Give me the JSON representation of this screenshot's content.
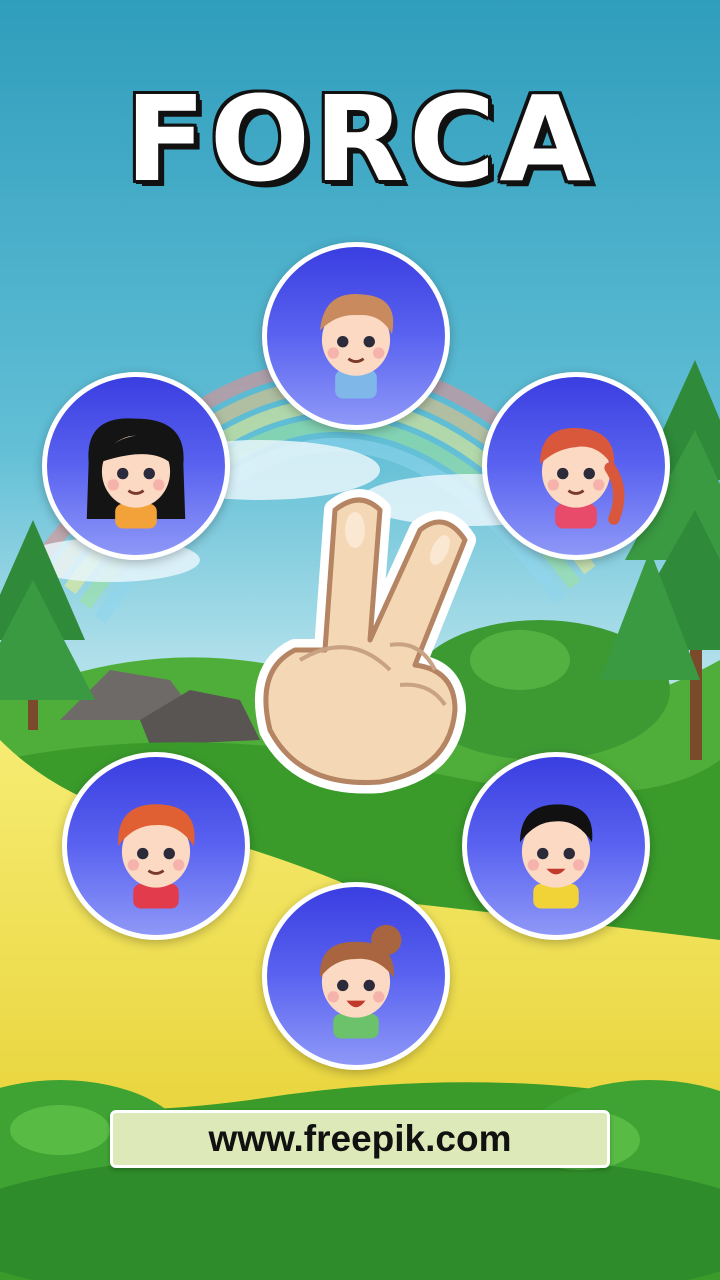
{
  "title": "FORCA",
  "footer": {
    "link_text": "www.freepik.com"
  },
  "hand": {
    "icon": "peace-hand-icon"
  },
  "avatars": [
    {
      "id": "boy-brown-hair",
      "hair": "#c98a5e",
      "shirt": "#7fb8e8",
      "skin": "#fbd9c2"
    },
    {
      "id": "girl-black-hair",
      "hair": "#141414",
      "shirt": "#f3a23a",
      "skin": "#fbd9c2"
    },
    {
      "id": "girl-red-braid",
      "hair": "#d9573b",
      "shirt": "#e84a6a",
      "skin": "#fbd9c2"
    },
    {
      "id": "boy-red-hair",
      "hair": "#e06034",
      "shirt": "#e23b4b",
      "skin": "#fbd9c2"
    },
    {
      "id": "boy-black-hair",
      "hair": "#111111",
      "shirt": "#f2d337",
      "skin": "#fbd9c2"
    },
    {
      "id": "girl-brown-bun",
      "hair": "#a8653f",
      "shirt": "#6cc26a",
      "skin": "#fbd9c2"
    }
  ],
  "colors": {
    "sky": "#3aa7c4",
    "grass": "#3a9b2b",
    "path": "#f2e35a"
  }
}
